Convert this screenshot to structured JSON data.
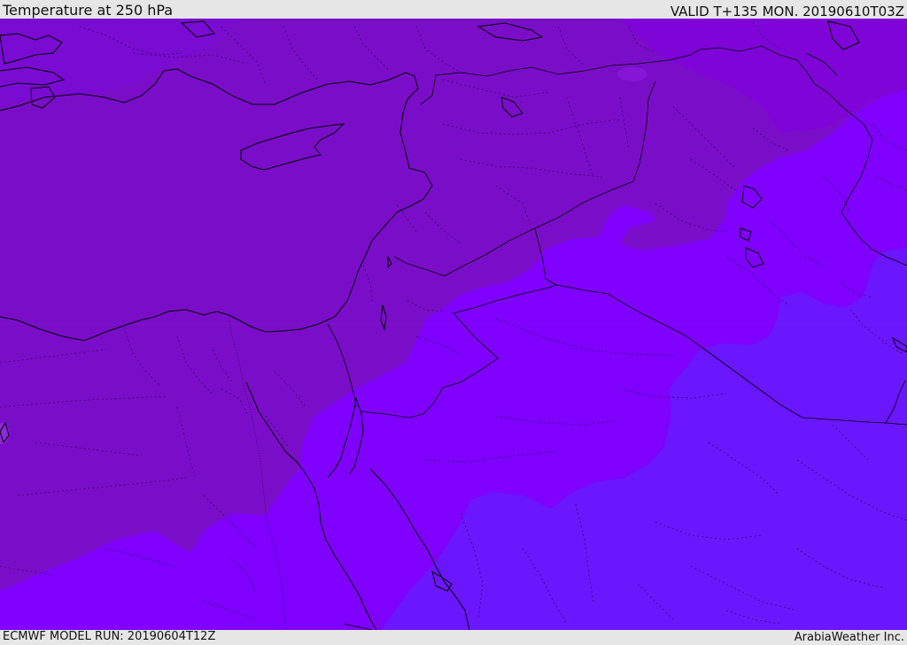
{
  "header": {
    "title": "Temperature at 250 hPa",
    "valid_time": "VALID T+135 MON. 20190610T03Z"
  },
  "footer": {
    "model_run": "ECMWF MODEL RUN: 20190604T12Z",
    "credit": "ArabiaWeather Inc."
  },
  "map": {
    "field": "temperature",
    "level": "250 hPa",
    "colors": {
      "band_warmest": "#7a0ec8",
      "band_warm_patch": "#800ad4",
      "band_mid": "#7f00ff",
      "band_cooler": "#6a16ff",
      "coastline": "#000000",
      "border": "#000000",
      "province": "#2a0050"
    }
  }
}
